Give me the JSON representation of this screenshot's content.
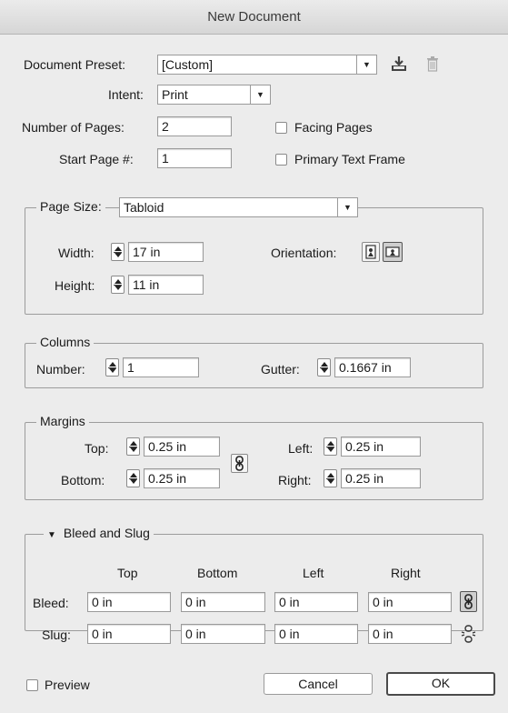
{
  "window": {
    "title": "New Document"
  },
  "preset": {
    "label": "Document Preset:",
    "value": "[Custom]",
    "save_icon": "save-preset-icon",
    "delete_icon": "trash-icon"
  },
  "intent": {
    "label": "Intent:",
    "value": "Print"
  },
  "pages": {
    "label": "Number of Pages:",
    "value": "2"
  },
  "start_page": {
    "label": "Start Page #:",
    "value": "1"
  },
  "facing_pages": {
    "label": "Facing Pages",
    "checked": false
  },
  "primary_text_frame": {
    "label": "Primary Text Frame",
    "checked": false
  },
  "page_size": {
    "label": "Page Size:",
    "value": "Tabloid",
    "width_label": "Width:",
    "width": "17 in",
    "height_label": "Height:",
    "height": "11 in",
    "orientation_label": "Orientation:",
    "orientation_selected": "landscape"
  },
  "columns": {
    "legend": "Columns",
    "number_label": "Number:",
    "number": "1",
    "gutter_label": "Gutter:",
    "gutter": "0.1667 in"
  },
  "margins": {
    "legend": "Margins",
    "top_label": "Top:",
    "top": "0.25 in",
    "bottom_label": "Bottom:",
    "bottom": "0.25 in",
    "left_label": "Left:",
    "left": "0.25 in",
    "right_label": "Right:",
    "right": "0.25 in"
  },
  "bleed_slug": {
    "legend": "Bleed and Slug",
    "headers": [
      "Top",
      "Bottom",
      "Left",
      "Right"
    ],
    "bleed_label": "Bleed:",
    "bleed": [
      "0 in",
      "0 in",
      "0 in",
      "0 in"
    ],
    "slug_label": "Slug:",
    "slug": [
      "0 in",
      "0 in",
      "0 in",
      "0 in"
    ]
  },
  "preview": {
    "label": "Preview",
    "checked": false
  },
  "buttons": {
    "cancel": "Cancel",
    "ok": "OK"
  }
}
